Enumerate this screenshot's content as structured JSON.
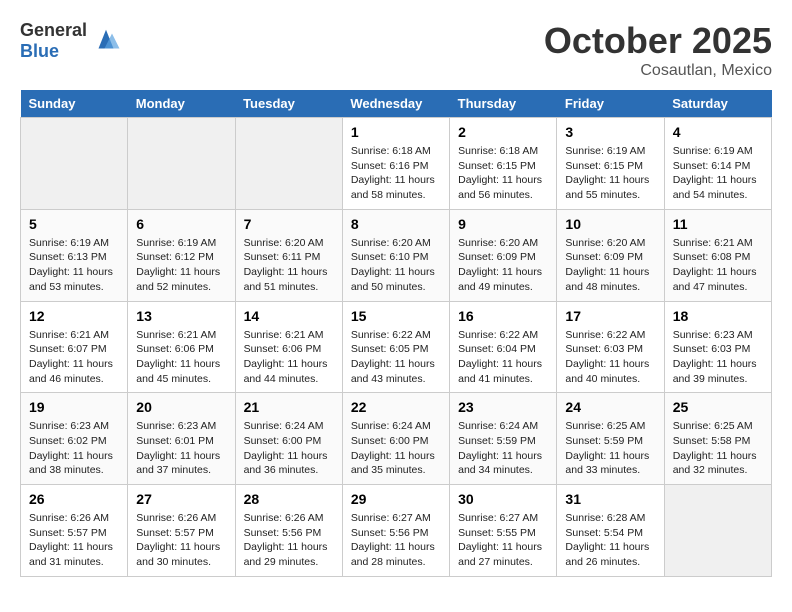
{
  "header": {
    "logo_general": "General",
    "logo_blue": "Blue",
    "month": "October 2025",
    "location": "Cosautlan, Mexico"
  },
  "days_of_week": [
    "Sunday",
    "Monday",
    "Tuesday",
    "Wednesday",
    "Thursday",
    "Friday",
    "Saturday"
  ],
  "weeks": [
    [
      {
        "day": "",
        "empty": true
      },
      {
        "day": "",
        "empty": true
      },
      {
        "day": "",
        "empty": true
      },
      {
        "day": "1",
        "sunrise": "6:18 AM",
        "sunset": "6:16 PM",
        "daylight": "11 hours and 58 minutes."
      },
      {
        "day": "2",
        "sunrise": "6:18 AM",
        "sunset": "6:15 PM",
        "daylight": "11 hours and 56 minutes."
      },
      {
        "day": "3",
        "sunrise": "6:19 AM",
        "sunset": "6:15 PM",
        "daylight": "11 hours and 55 minutes."
      },
      {
        "day": "4",
        "sunrise": "6:19 AM",
        "sunset": "6:14 PM",
        "daylight": "11 hours and 54 minutes."
      }
    ],
    [
      {
        "day": "5",
        "sunrise": "6:19 AM",
        "sunset": "6:13 PM",
        "daylight": "11 hours and 53 minutes."
      },
      {
        "day": "6",
        "sunrise": "6:19 AM",
        "sunset": "6:12 PM",
        "daylight": "11 hours and 52 minutes."
      },
      {
        "day": "7",
        "sunrise": "6:20 AM",
        "sunset": "6:11 PM",
        "daylight": "11 hours and 51 minutes."
      },
      {
        "day": "8",
        "sunrise": "6:20 AM",
        "sunset": "6:10 PM",
        "daylight": "11 hours and 50 minutes."
      },
      {
        "day": "9",
        "sunrise": "6:20 AM",
        "sunset": "6:09 PM",
        "daylight": "11 hours and 49 minutes."
      },
      {
        "day": "10",
        "sunrise": "6:20 AM",
        "sunset": "6:09 PM",
        "daylight": "11 hours and 48 minutes."
      },
      {
        "day": "11",
        "sunrise": "6:21 AM",
        "sunset": "6:08 PM",
        "daylight": "11 hours and 47 minutes."
      }
    ],
    [
      {
        "day": "12",
        "sunrise": "6:21 AM",
        "sunset": "6:07 PM",
        "daylight": "11 hours and 46 minutes."
      },
      {
        "day": "13",
        "sunrise": "6:21 AM",
        "sunset": "6:06 PM",
        "daylight": "11 hours and 45 minutes."
      },
      {
        "day": "14",
        "sunrise": "6:21 AM",
        "sunset": "6:06 PM",
        "daylight": "11 hours and 44 minutes."
      },
      {
        "day": "15",
        "sunrise": "6:22 AM",
        "sunset": "6:05 PM",
        "daylight": "11 hours and 43 minutes."
      },
      {
        "day": "16",
        "sunrise": "6:22 AM",
        "sunset": "6:04 PM",
        "daylight": "11 hours and 41 minutes."
      },
      {
        "day": "17",
        "sunrise": "6:22 AM",
        "sunset": "6:03 PM",
        "daylight": "11 hours and 40 minutes."
      },
      {
        "day": "18",
        "sunrise": "6:23 AM",
        "sunset": "6:03 PM",
        "daylight": "11 hours and 39 minutes."
      }
    ],
    [
      {
        "day": "19",
        "sunrise": "6:23 AM",
        "sunset": "6:02 PM",
        "daylight": "11 hours and 38 minutes."
      },
      {
        "day": "20",
        "sunrise": "6:23 AM",
        "sunset": "6:01 PM",
        "daylight": "11 hours and 37 minutes."
      },
      {
        "day": "21",
        "sunrise": "6:24 AM",
        "sunset": "6:00 PM",
        "daylight": "11 hours and 36 minutes."
      },
      {
        "day": "22",
        "sunrise": "6:24 AM",
        "sunset": "6:00 PM",
        "daylight": "11 hours and 35 minutes."
      },
      {
        "day": "23",
        "sunrise": "6:24 AM",
        "sunset": "5:59 PM",
        "daylight": "11 hours and 34 minutes."
      },
      {
        "day": "24",
        "sunrise": "6:25 AM",
        "sunset": "5:59 PM",
        "daylight": "11 hours and 33 minutes."
      },
      {
        "day": "25",
        "sunrise": "6:25 AM",
        "sunset": "5:58 PM",
        "daylight": "11 hours and 32 minutes."
      }
    ],
    [
      {
        "day": "26",
        "sunrise": "6:26 AM",
        "sunset": "5:57 PM",
        "daylight": "11 hours and 31 minutes."
      },
      {
        "day": "27",
        "sunrise": "6:26 AM",
        "sunset": "5:57 PM",
        "daylight": "11 hours and 30 minutes."
      },
      {
        "day": "28",
        "sunrise": "6:26 AM",
        "sunset": "5:56 PM",
        "daylight": "11 hours and 29 minutes."
      },
      {
        "day": "29",
        "sunrise": "6:27 AM",
        "sunset": "5:56 PM",
        "daylight": "11 hours and 28 minutes."
      },
      {
        "day": "30",
        "sunrise": "6:27 AM",
        "sunset": "5:55 PM",
        "daylight": "11 hours and 27 minutes."
      },
      {
        "day": "31",
        "sunrise": "6:28 AM",
        "sunset": "5:54 PM",
        "daylight": "11 hours and 26 minutes."
      },
      {
        "day": "",
        "empty": true
      }
    ]
  ]
}
